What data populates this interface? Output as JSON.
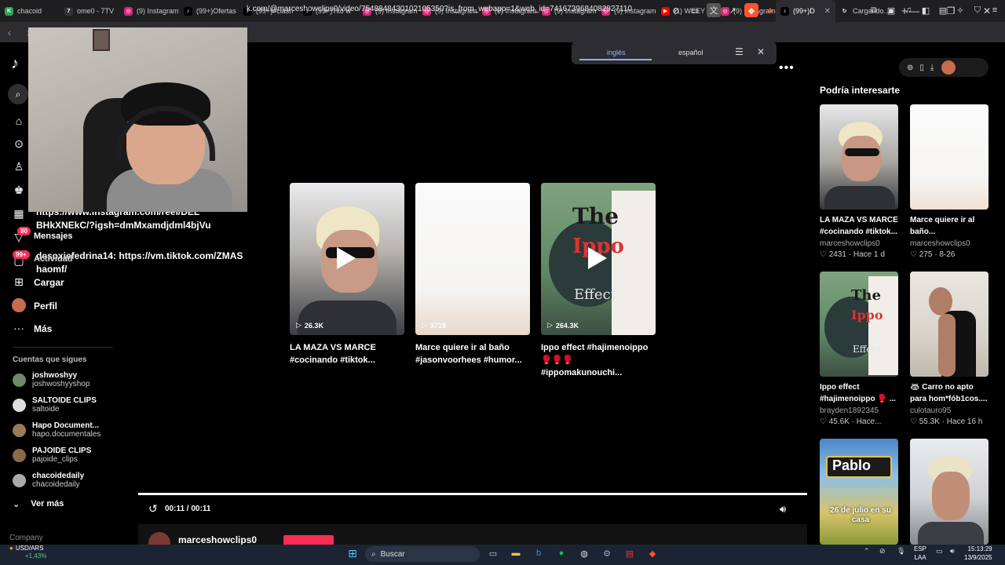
{
  "browser": {
    "tabs": [
      {
        "label": "chacoid",
        "icon_color": "#2ea44f",
        "icon_glyph": "K"
      },
      {
        "label": "ome0 - 7TV",
        "icon_color": "#333",
        "icon_glyph": "7"
      },
      {
        "label": "(9) Instagram",
        "icon_color": "#d62976",
        "icon_glyph": "◎"
      },
      {
        "label": "(99+)Ofertas",
        "icon_color": "#000",
        "icon_glyph": "♪"
      },
      {
        "label": "(99+)#clash",
        "icon_color": "#000",
        "icon_glyph": "♪"
      },
      {
        "label": "(99+)Tito w",
        "icon_color": "#000",
        "icon_glyph": "♪"
      },
      {
        "label": "(9) Instagram",
        "icon_color": "#d62976",
        "icon_glyph": "◎"
      },
      {
        "label": "(9) Instagram",
        "icon_color": "#d62976",
        "icon_glyph": "◎"
      },
      {
        "label": "(9) Instagram",
        "icon_color": "#d62976",
        "icon_glyph": "◎"
      },
      {
        "label": "(9) Instagram",
        "icon_color": "#d62976",
        "icon_glyph": "◎"
      },
      {
        "label": "(9) Instagram",
        "icon_color": "#d62976",
        "icon_glyph": "◎"
      },
      {
        "label": "(1) WEEY O",
        "icon_color": "#ff0000",
        "icon_glyph": "▶"
      },
      {
        "label": "(9) Instagram",
        "icon_color": "#d62976",
        "icon_glyph": "◎"
      },
      {
        "label": "(99+)D",
        "icon_color": "#000",
        "icon_glyph": "♪"
      },
      {
        "label": "Cargando...",
        "icon_color": "#1f1f22",
        "icon_glyph": "↻"
      }
    ],
    "close_glyph": "✕",
    "new_tab_glyph": "+",
    "url": "k.com/@marceshowclips0/video/7548848430102105350?is_from_webapp=1&web_id=7416739684082927110"
  },
  "translate_popup": {
    "source_lang": "inglés",
    "target_lang": "español"
  },
  "sidebar": {
    "nav": [
      {
        "label": "Cargar",
        "icon": "plus-square-icon"
      },
      {
        "label": "Perfil",
        "icon": "avatar"
      },
      {
        "label": "Más",
        "icon": "more-icon"
      }
    ],
    "overlay_chat": [
      "BHkXNEkC/?igsh=dmMxamdjdml4bjVu",
      "Mensajes",
      "desoxiefedrina14: https://vm.tiktok.com/ZMAS",
      "haomf/",
      "Actividad"
    ],
    "overlay_partial": "https://www.instagram.com/reel/DEL",
    "badges": {
      "messages": "80",
      "activity": "99+"
    },
    "following_title": "Cuentas que sigues",
    "following": [
      {
        "name": "joshwoshyy",
        "handle": "joshwoshyyshop",
        "color": "#6f8a6b"
      },
      {
        "name": "SALTOIDE CLIPS",
        "handle": "saltoide",
        "color": "#ddd"
      },
      {
        "name": "Hapo Document...",
        "handle": "hapo.documentales",
        "color": "#9a7a5a"
      },
      {
        "name": "PAJOIDE CLIPS",
        "handle": "pajoide_clips",
        "color": "#8a6a4a"
      },
      {
        "name": "chacoidedaily",
        "handle": "chacoidedaily",
        "color": "#aaa"
      }
    ],
    "see_more": "Ver más",
    "company": "Company"
  },
  "related": [
    {
      "views": "26.3K",
      "title_1": "LA MAZA VS MARCE",
      "title_2": "#cocinando #tiktok..."
    },
    {
      "views": "3718",
      "title_1": "Marce quiere ir al baño",
      "title_2": "#jasonvoorhees #humor..."
    },
    {
      "views": "264.3K",
      "title_1": "Ippo effect #hajimenoippo",
      "title_2": "🥊🥊🥊 #ippomakunouchi..."
    }
  ],
  "player": {
    "time": "00:11 / 00:11",
    "author": "marceshowclips0"
  },
  "suggestions": {
    "title": "Podría interesarte",
    "items": [
      {
        "title": "LA MAZA VS MARCE #cocinando #tiktok...",
        "user": "marceshowclips0",
        "likes": "2431",
        "when": "Hace 1 d"
      },
      {
        "title": "Marce quiere ir al baño...",
        "user": "marceshowclips0",
        "likes": "275",
        "when": "8-26"
      },
      {
        "title": "Ippo effect #hajimenoippo 🥊 ...",
        "user": "brayden1892345",
        "likes": "45.6K",
        "when": "Hace..."
      },
      {
        "title": "🦝 Carro no apto para hom*fób1cos....",
        "user": "culotauro95",
        "likes": "55.3K",
        "when": "Hace 16 h"
      }
    ],
    "thumb_text_pablo": "Pablo",
    "thumb_text_date": "26 de julio en su casa"
  },
  "thumb_overlay": {
    "the": "The",
    "ippo": "Ippo",
    "effect": "Effect"
  },
  "taskbar": {
    "ticker": "USD/ARS",
    "change": "+1,43%",
    "search": "Buscar",
    "lang_1": "ESP",
    "lang_2": "LAA",
    "time": "15:13:29",
    "date": "13/9/2025"
  }
}
